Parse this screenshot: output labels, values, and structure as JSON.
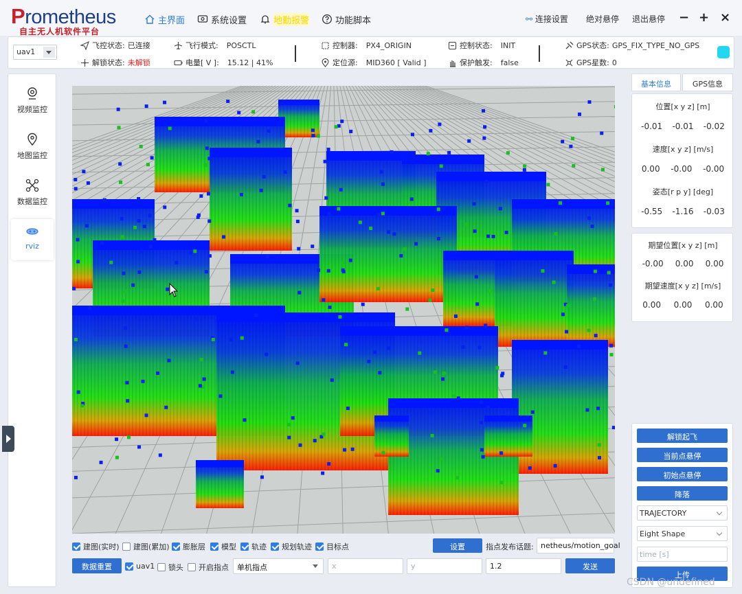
{
  "app": {
    "logo_main_first": "P",
    "logo_main_rest": "rometheus",
    "logo_sub": "自主无人机软件平台"
  },
  "nav": {
    "home": "主界面",
    "settings": "系统设置",
    "alert": "地勤报警",
    "scripts": "功能脚本"
  },
  "titlebar": {
    "connect": "连接设置",
    "abs_hover": "绝对悬停",
    "exit_hover": "退出悬停",
    "minimize": "−",
    "maximize": "+",
    "close": "×"
  },
  "status": {
    "uav": "uav1",
    "fc_label": "飞控状态:",
    "fc_value": "已连接",
    "arm_label": "解锁状态:",
    "arm_value": "未解锁",
    "mode_label": "飞行模式:",
    "mode_value": "POSCTL",
    "battery_label": "电量[ V ]:",
    "battery_value": "15.12 | 41%",
    "controller_label": "控制器:",
    "controller_value": "PX4_ORIGIN",
    "locsrc_label": "定位源:",
    "locsrc_value": "MID360 [ Valid ]",
    "ctrl_state_label": "控制状态:",
    "ctrl_state_value": "INIT",
    "protect_label": "保护触发:",
    "protect_value": "false",
    "gps_label": "GPS状态:",
    "gps_value": "GPS_FIX_TYPE_NO_GPS",
    "gps_sats_label": "GPS星数:",
    "gps_sats_value": "0",
    "gps_dot_color": "#22d8f0"
  },
  "sidebar": {
    "items": [
      {
        "label": "视频监控",
        "icon": "camera-icon"
      },
      {
        "label": "地图监控",
        "icon": "map-pin-icon"
      },
      {
        "label": "数据监控",
        "icon": "drone-icon"
      },
      {
        "label": "rviz",
        "icon": "rviz-icon"
      }
    ]
  },
  "bottom": {
    "cb_mapping_rt": "建图(实时)",
    "cb_mapping_acc": "建图(累加)",
    "cb_inflation": "膨胀层",
    "cb_model": "模型",
    "cb_trajectory": "轨迹",
    "cb_plan_traj": "规划轨迹",
    "cb_target": "目标点",
    "settings_btn": "设置",
    "topic_label": "指点发布话题:",
    "topic_value": "netheus/motion_goal",
    "reset_btn": "数据重置",
    "cb_uav1": "uav1",
    "cb_lock": "锁头",
    "cb_pointing": "开启指点",
    "mode_select": "单机指点",
    "x_placeholder": "x",
    "y_placeholder": "y",
    "z_value": "1.2",
    "send_btn": "发送"
  },
  "right": {
    "tab_basic": "基本信息",
    "tab_gps": "GPS信息",
    "pos_title": "位置[x y z] [m]",
    "pos": [
      "-0.01",
      "-0.01",
      "-0.02"
    ],
    "vel_title": "速度[x y z] [m/s]",
    "vel": [
      "0.00",
      "-0.00",
      "-0.00"
    ],
    "att_title": "姿态[r p y] [deg]",
    "att": [
      "-0.55",
      "-1.16",
      "-0.03"
    ],
    "des_pos_title": "期望位置[x y z] [m]",
    "des_pos": [
      "-0.00",
      "0.00",
      "0.00"
    ],
    "des_vel_title": "期望速度[x y z] [m/s]",
    "des_vel": [
      "0.00",
      "0.00",
      "0.00"
    ],
    "btn_takeoff": "解锁起飞",
    "btn_hover_cur": "当前点悬停",
    "btn_hover_init": "初始点悬停",
    "btn_land": "降落",
    "sel_traj": "TRAJECTORY",
    "sel_shape": "Eight Shape",
    "time_placeholder": "time [s]",
    "btn_upload": "上传"
  },
  "watermark": "CSDN @undefined"
}
